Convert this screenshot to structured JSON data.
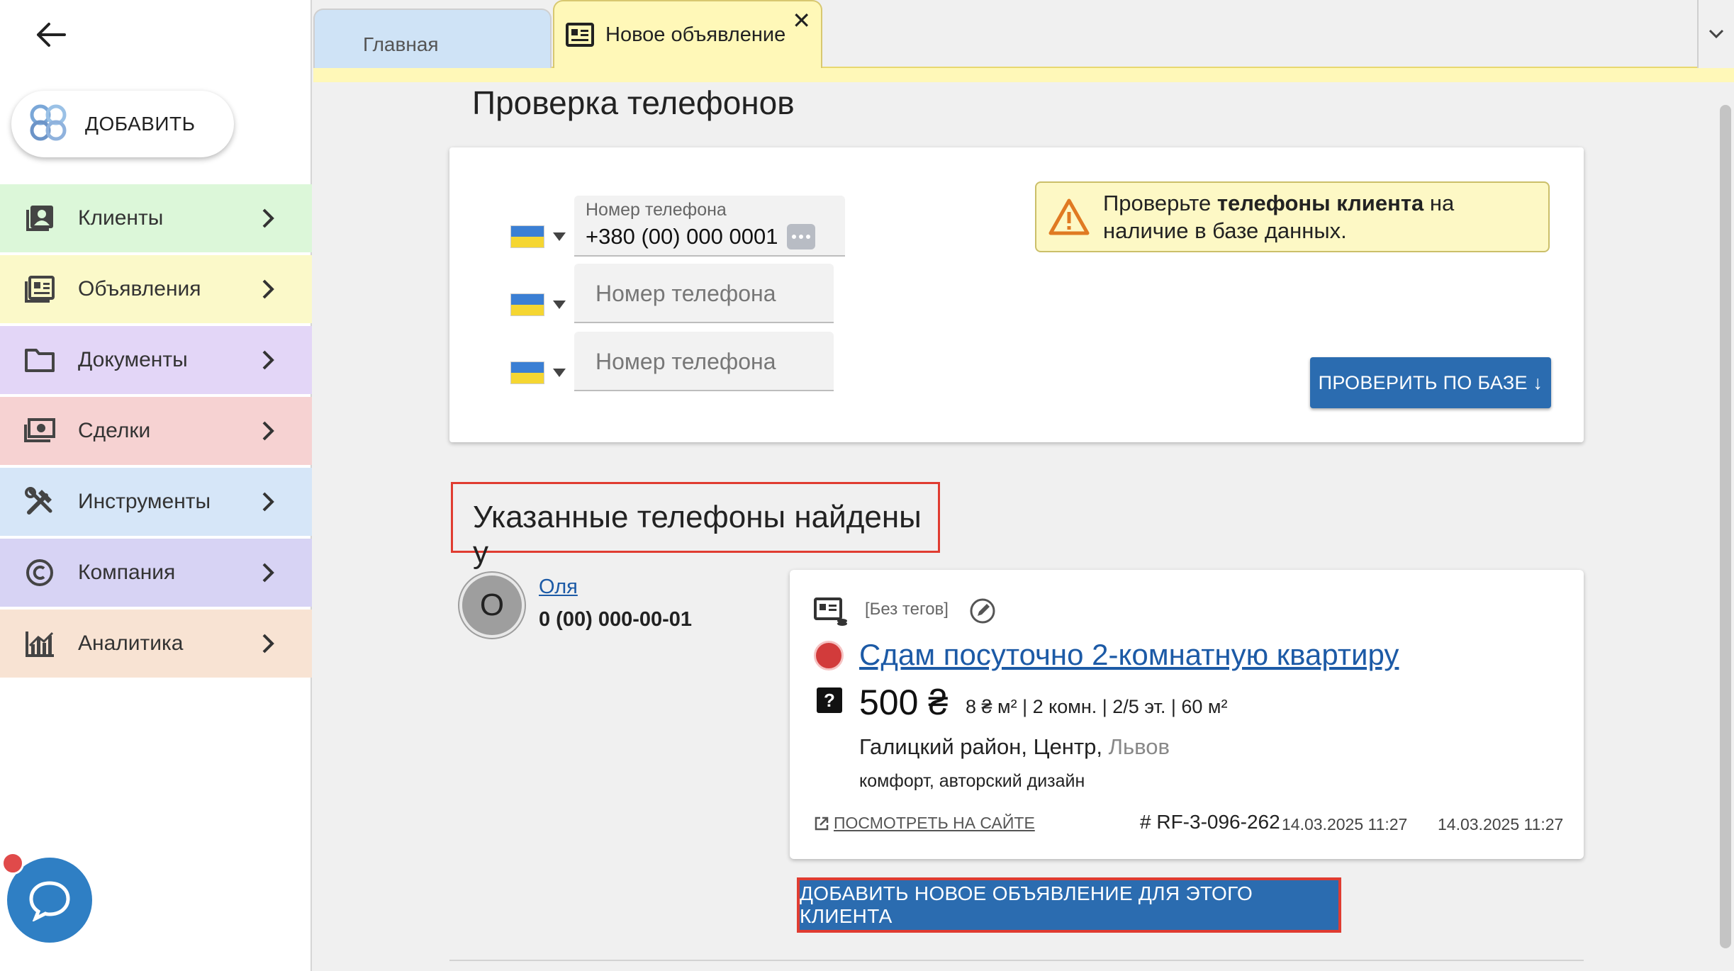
{
  "sidebar": {
    "add_label": "ДОБАВИТЬ",
    "items": [
      {
        "label": "Клиенты",
        "color": "#dcf7d9"
      },
      {
        "label": "Объявления",
        "color": "#fbf9c9"
      },
      {
        "label": "Документы",
        "color": "#e3d6f7"
      },
      {
        "label": "Сделки",
        "color": "#f6d2d2"
      },
      {
        "label": "Инструменты",
        "color": "#d6e6f8"
      },
      {
        "label": "Компания",
        "color": "#d7d3f4"
      },
      {
        "label": "Аналитика",
        "color": "#f8e3d3"
      }
    ]
  },
  "tabs": {
    "main_label": "Главная",
    "new_label": "Новое объявление",
    "close_label": "✕"
  },
  "phones": {
    "title": "Проверка телефонов",
    "field_label": "Номер телефона",
    "first_value": "+380 (00) 000 0001",
    "placeholder": "Номер телефона",
    "warning_prefix": "Проверьте ",
    "warning_bold": "телефоны клиента",
    "warning_suffix": " на",
    "warning_line2": "наличие в базе данных.",
    "check_button": "ПРОВЕРИТЬ ПО БАЗЕ ↓"
  },
  "found": {
    "title": "Указанные телефоны найдены у",
    "client": {
      "initial": "О",
      "name": "Оля",
      "phone": "0 (00) 000-00-01"
    },
    "listing": {
      "tags": "[Без тегов]",
      "title": "Сдам посуточно 2-комнатную квартиру",
      "price": "500 ₴",
      "specs": "8 ₴ м² | 2 комн. | 2/5 эт. | 60 м²",
      "location": "Галицкий район, Центр, ",
      "city": "Львов",
      "description": "комфорт, авторский дизайн",
      "view_site": "ПОСМОТРЕТЬ НА САЙТЕ",
      "ref": "# RF-3-096-262",
      "created": "14.03.2025 11:27",
      "updated": "14.03.2025 11:27"
    },
    "add_button": "ДОБАВИТЬ НОВОЕ ОБЪЯВЛЕНИЕ ДЛЯ ЭТОГО КЛИЕНТА"
  }
}
